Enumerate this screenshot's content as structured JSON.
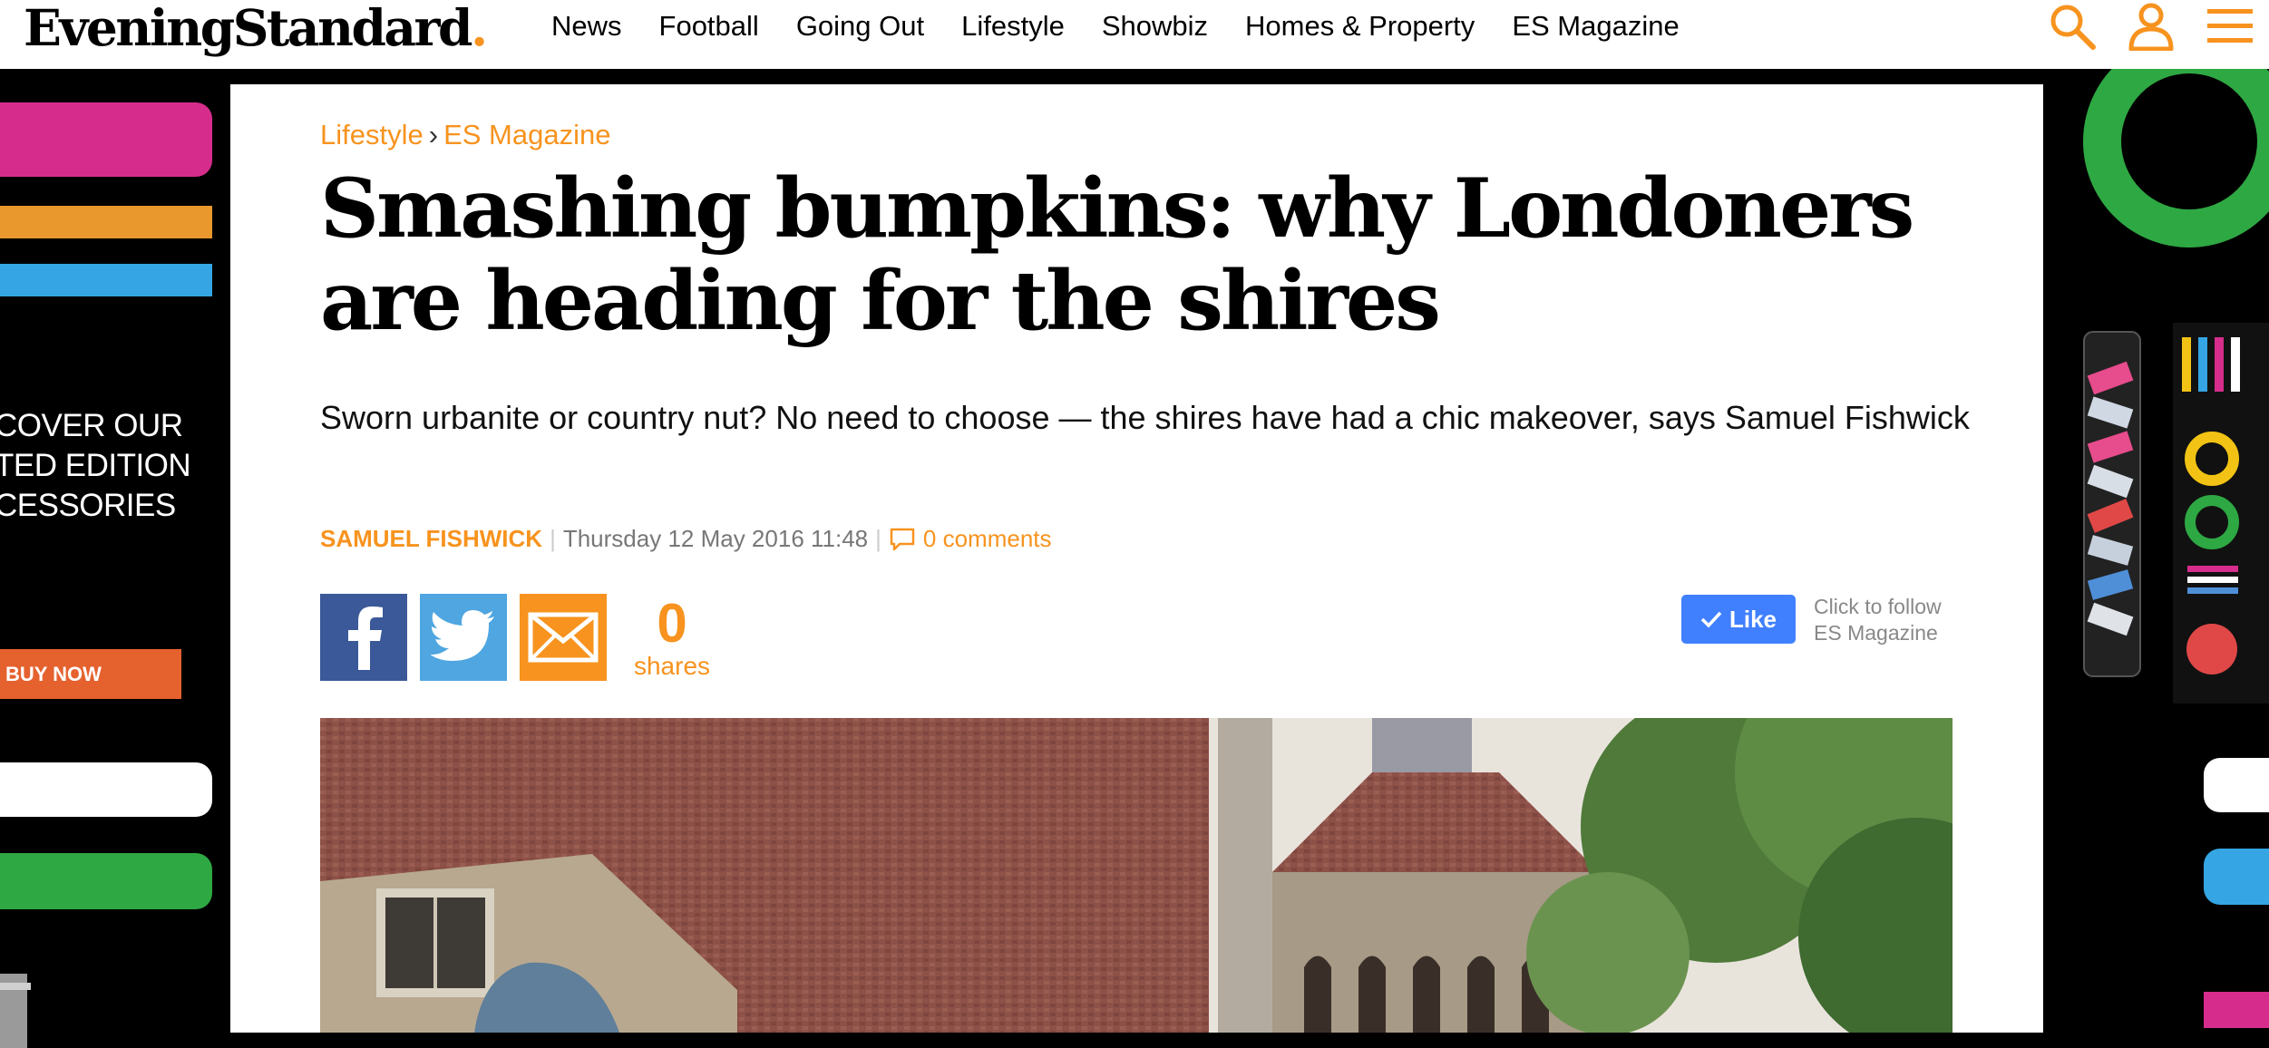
{
  "header": {
    "logo_text": "EveningStandard",
    "logo_dot": ".",
    "nav": [
      "News",
      "Football",
      "Going Out",
      "Lifestyle",
      "Showbiz",
      "Homes & Property",
      "ES Magazine"
    ],
    "icons": [
      "search-icon",
      "user-icon",
      "menu-icon"
    ],
    "accent_color": "#f7931e"
  },
  "ad_left": {
    "text": "COVER OUR\nTED EDITION\nCESSORIES",
    "button": "BUY NOW"
  },
  "article": {
    "breadcrumb": [
      "Lifestyle",
      "ES Magazine"
    ],
    "breadcrumb_sep": "›",
    "headline": "Smashing bumpkins: why Londoners are heading for the shires",
    "standfirst": "Sworn urbanite or country nut? No need to choose — the shires have had a chic makeover, says Samuel Fishwick",
    "author": "SAMUEL FISHWICK",
    "date": "Thursday 12 May 2016 11:48",
    "comments": "0 comments",
    "share_count": "0",
    "share_label": "shares",
    "like_label": "Like",
    "follow_line1": "Click to follow",
    "follow_line2": "ES Magazine"
  }
}
